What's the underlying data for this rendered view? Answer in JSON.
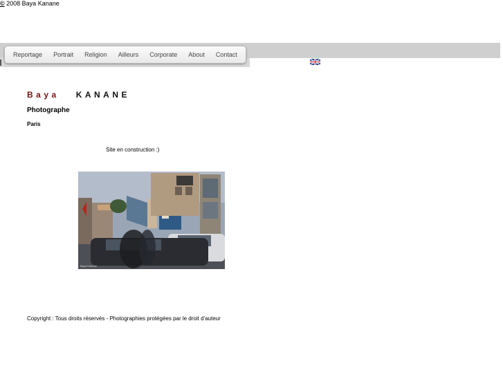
{
  "top": {
    "copyright_symbol": "©",
    "copyright_text": "2008 Baya Kanane"
  },
  "nav": {
    "items": [
      {
        "label": "Reportage"
      },
      {
        "label": "Portrait"
      },
      {
        "label": "Religion"
      },
      {
        "label": "Ailleurs"
      },
      {
        "label": "Corporate"
      },
      {
        "label": "About"
      },
      {
        "label": "Contact"
      }
    ]
  },
  "language": {
    "flag_icon": "uk-flag-icon"
  },
  "header": {
    "first_name": "Baya",
    "last_name": "KANANE",
    "role": "Photographe",
    "city": "Paris"
  },
  "main": {
    "construction_text": "Site en construction :)",
    "photo_watermark": "Baya Kanane"
  },
  "footer": {
    "text": "Copyright : Tous droits réservés  -  Photographies protégées par le droit d'auteur"
  },
  "colors": {
    "accent_first_name": "#7a1212",
    "nav_band": "#cfcfcf"
  }
}
